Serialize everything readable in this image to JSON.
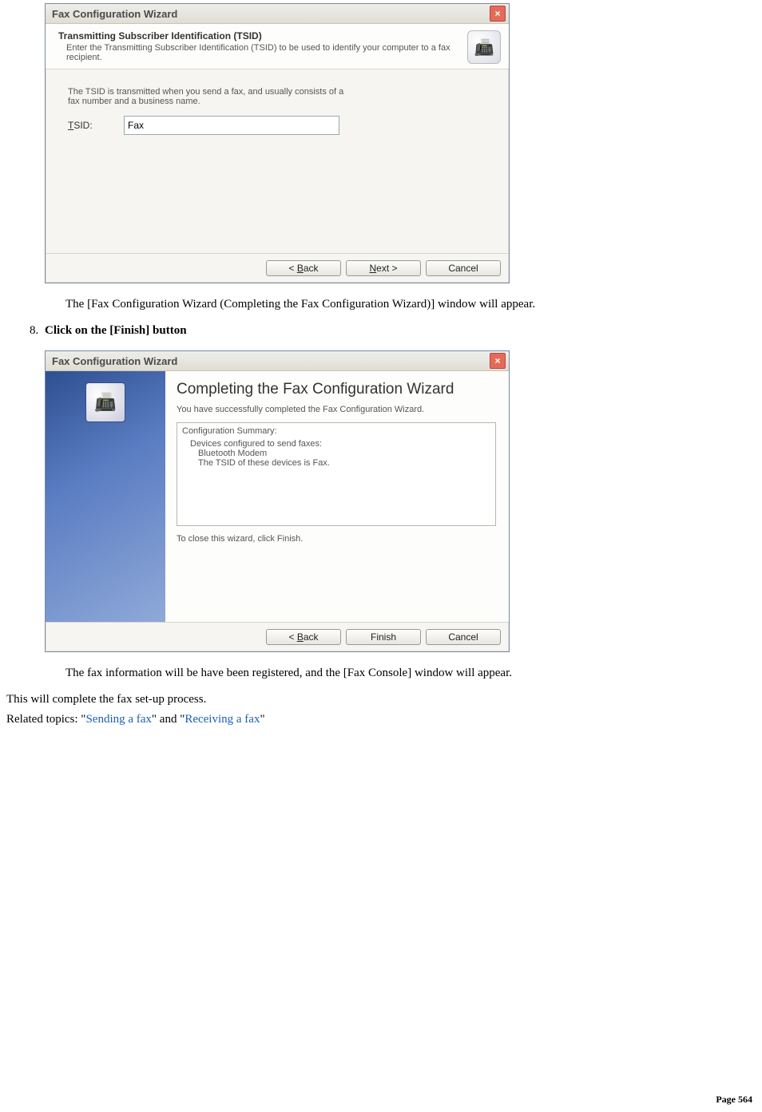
{
  "dialog1": {
    "title": "Fax Configuration Wizard",
    "header": "Transmitting Subscriber Identification (TSID)",
    "subtext": "Enter the Transmitting Subscriber Identification (TSID) to be used to identify your computer to a fax recipient.",
    "bodytext": "The TSID is transmitted when you send a fax, and usually consists of a fax number and a business name.",
    "tsid_label_pre": "T",
    "tsid_label_post": "SID:",
    "tsid_value": "Fax",
    "icon": "📠",
    "btn_back_pre": "< ",
    "btn_back_u": "B",
    "btn_back_post": "ack",
    "btn_next_u": "N",
    "btn_next_post": "ext >",
    "btn_cancel": "Cancel"
  },
  "between_text": "The [Fax Configuration Wizard (Completing the Fax Configuration Wizard)] window will appear.",
  "step": {
    "num": "8.",
    "text": "Click on the [Finish] button"
  },
  "dialog2": {
    "title": "Fax Configuration Wizard",
    "icon": "📠",
    "heading": "Completing the Fax Configuration Wizard",
    "subtext": "You have successfully completed the Fax Configuration Wizard.",
    "summary_label": "Configuration Summary:",
    "summary_l1": "Devices configured to send faxes:",
    "summary_l2": "Bluetooth Modem",
    "summary_l3": "The TSID of these devices is Fax.",
    "closing": "To close this wizard, click Finish.",
    "btn_back_pre": "< ",
    "btn_back_u": "B",
    "btn_back_post": "ack",
    "btn_finish": "Finish",
    "btn_cancel": "Cancel"
  },
  "after_text": "The fax information will be have been registered, and the [Fax Console] window will appear.",
  "closing_line": "This will complete the fax set-up process.",
  "related_pre": "Related topics: \"",
  "related_link1": "Sending a fax",
  "related_mid": "\" and \"",
  "related_link2": "Receiving a fax",
  "related_post": "\"",
  "page_label": "Page 564"
}
